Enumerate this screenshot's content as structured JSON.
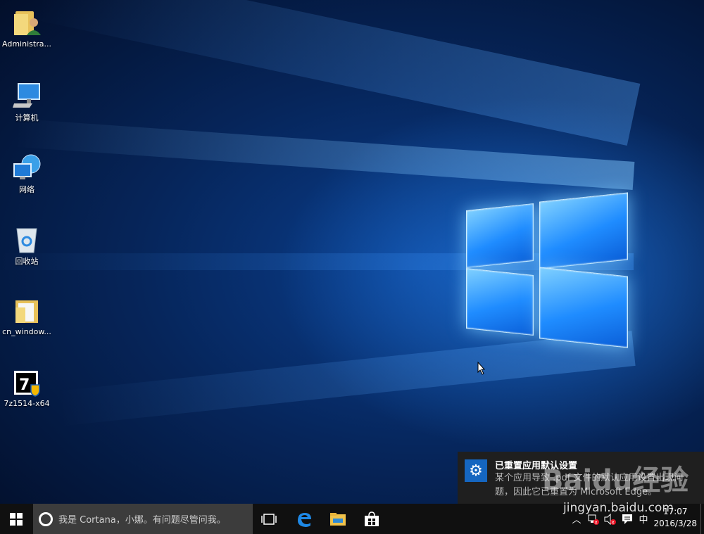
{
  "desktop": {
    "icons": [
      {
        "label": "Administra...",
        "icon": "user-folder-icon"
      },
      {
        "label": "计算机",
        "icon": "computer-icon"
      },
      {
        "label": "网络",
        "icon": "network-icon"
      },
      {
        "label": "回收站",
        "icon": "recycle-bin-icon"
      },
      {
        "label": "cn_window...",
        "icon": "folder-icon"
      },
      {
        "label": "7z1514-x64",
        "icon": "7zip-installer-icon"
      }
    ]
  },
  "toast": {
    "title": "已重置应用默认设置",
    "body": "某个应用导致 .pdf 文件的默认应用设置出现问题，因此它已重置为 Microsoft Edge。",
    "icon": "gear-icon",
    "accent": "#1566c0"
  },
  "taskbar": {
    "search_placeholder": "我是 Cortana，小娜。有问题尽管问我。",
    "apps": [
      "task-view-icon",
      "edge-icon",
      "file-explorer-icon",
      "store-icon"
    ],
    "tray": {
      "ime": "中",
      "time": "17:07",
      "date": "2016/3/28"
    }
  },
  "watermark": {
    "brand": "Baidu经验",
    "url": "jingyan.baidu.com"
  },
  "colors": {
    "taskbar": "#101010",
    "search": "#3c3c3c",
    "edge_blue": "#1e88e5"
  }
}
